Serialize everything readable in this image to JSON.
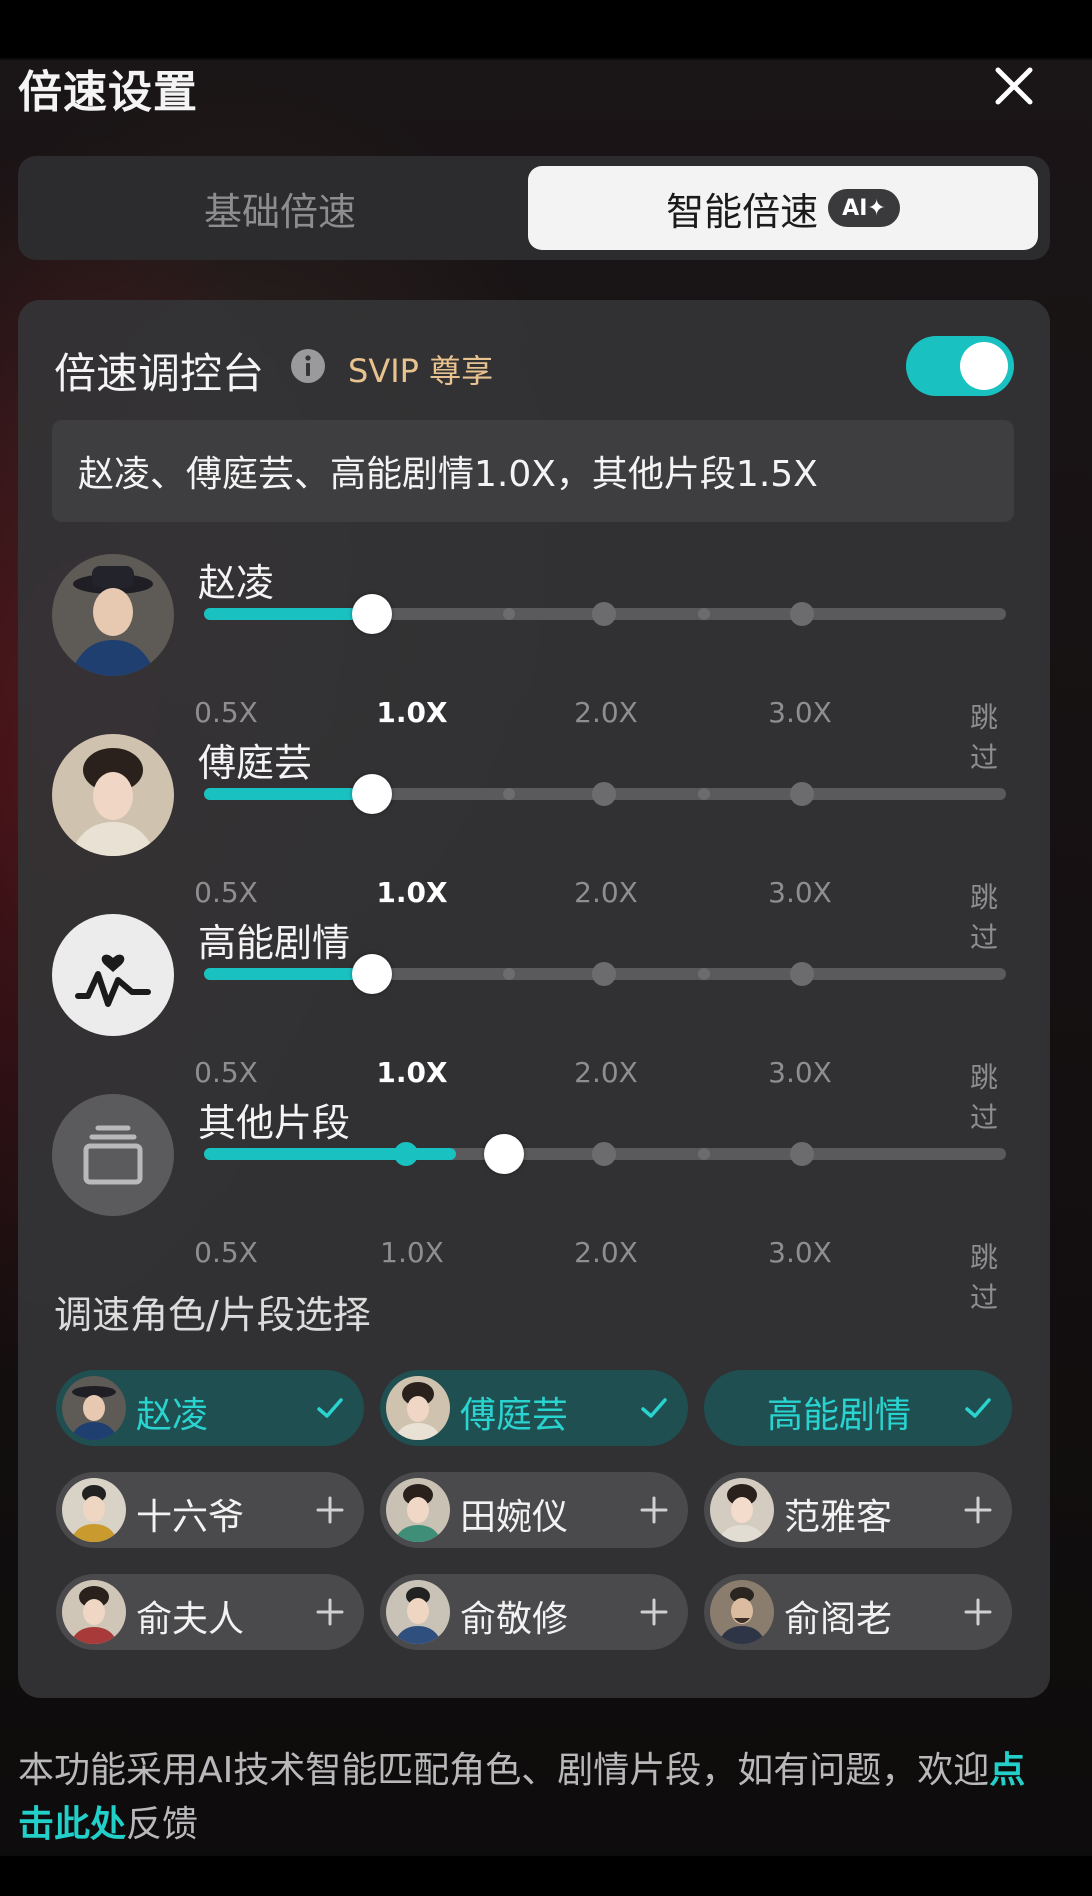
{
  "header": {
    "title": "倍速设置"
  },
  "tabs": [
    {
      "label": "基础倍速",
      "active": false
    },
    {
      "label": "智能倍速",
      "badge": "AI✦",
      "active": true
    }
  ],
  "console": {
    "title": "倍速调控台",
    "svip": "SVIP 尊享",
    "toggle_on": true,
    "summary": "赵凌、傅庭芸、高能剧情1.0X，其他片段1.5X"
  },
  "scale_labels": [
    "0.5X",
    "1.0X",
    "2.0X",
    "3.0X",
    "跳过"
  ],
  "speed_rows": [
    {
      "label": "赵凌",
      "selected_speed": "1.0X",
      "position": 0.25,
      "icon": "character-avatar"
    },
    {
      "label": "傅庭芸",
      "selected_speed": "1.0X",
      "position": 0.25,
      "icon": "character-avatar"
    },
    {
      "label": "高能剧情",
      "selected_speed": "1.0X",
      "position": 0.25,
      "icon": "heartbeat-icon"
    },
    {
      "label": "其他片段",
      "selected_speed": "1.5X",
      "position": 0.375,
      "icon": "stack-icon"
    }
  ],
  "selection": {
    "title": "调速角色/片段选择",
    "chips": [
      {
        "label": "赵凌",
        "selected": true
      },
      {
        "label": "傅庭芸",
        "selected": true
      },
      {
        "label": "高能剧情",
        "selected": true
      },
      {
        "label": "十六爷",
        "selected": false
      },
      {
        "label": "田婉仪",
        "selected": false
      },
      {
        "label": "范雅客",
        "selected": false
      },
      {
        "label": "俞夫人",
        "selected": false
      },
      {
        "label": "俞敬修",
        "selected": false
      },
      {
        "label": "俞阁老",
        "selected": false
      }
    ]
  },
  "footer": {
    "text_before": "本功能采用AI技术智能匹配角色、剧情片段，如有问题，欢迎",
    "link": "点击此处",
    "text_after": "反馈"
  },
  "colors": {
    "accent": "#19c2c1",
    "svip": "#e8c28f",
    "panel": "#343436"
  }
}
